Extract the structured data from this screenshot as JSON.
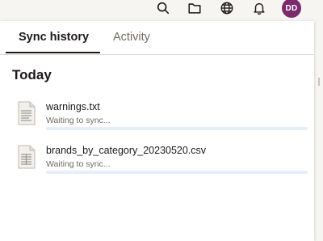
{
  "topbar": {
    "icons": [
      "search-icon",
      "folder-icon",
      "globe-icon",
      "bell-icon"
    ],
    "avatar_initials": "DD",
    "avatar_color": "#7b2b6b"
  },
  "tabs": [
    {
      "label": "Sync history",
      "active": true
    },
    {
      "label": "Activity",
      "active": false
    }
  ],
  "section": {
    "heading": "Today"
  },
  "files": [
    {
      "name": "warnings.txt",
      "status": "Waiting to sync...",
      "progress": 0,
      "icon": "text-file-icon"
    },
    {
      "name": "brands_by_category_20230520.csv",
      "status": "Waiting to sync...",
      "progress": 0,
      "icon": "csv-file-icon"
    }
  ],
  "colors": {
    "accent": "#0061fe",
    "progress_track": "#e6eefb",
    "text_primary": "#1e1919",
    "text_secondary": "#736c64"
  }
}
